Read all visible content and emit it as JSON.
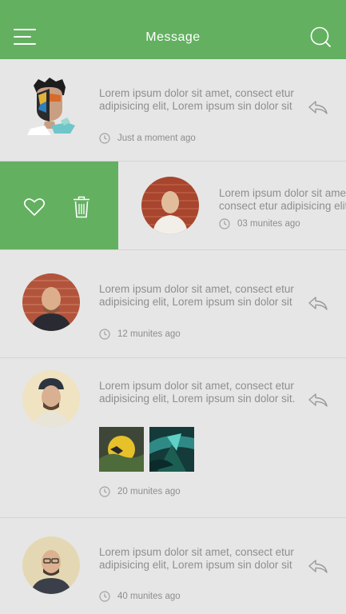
{
  "header": {
    "title": "Message",
    "menu_icon": "hamburger-menu-icon",
    "search_icon": "search-icon",
    "color": "#63b061"
  },
  "messages": [
    {
      "text": "Lorem ipsum dolor sit amet, consect etur adipisicing elit, Lorem ipsum sin dolor sit",
      "time": "Just a moment ago"
    },
    {
      "text": "Lorem ipsum dolor sit amet, consect etur adipisicing elit,",
      "time": "03 munites ago",
      "swiped": true,
      "actions": [
        "heart-icon",
        "trash-icon"
      ]
    },
    {
      "text": "Lorem ipsum dolor sit amet, consect etur adipisicing elit, Lorem ipsum sin dolor sit",
      "time": "12 munites ago"
    },
    {
      "text": "Lorem ipsum dolor sit amet, consect etur adipisicing elit, Lorem ipsum sin dolor sit.",
      "time": "20 munites ago",
      "attachments": 2
    },
    {
      "text": "Lorem ipsum dolor sit amet, consect etur adipisicing elit, Lorem ipsum sin dolor sit",
      "time": "40 munites ago"
    }
  ],
  "colors": {
    "accent": "#63b061",
    "background": "#e6e6e6",
    "text": "#8e8e8e"
  }
}
